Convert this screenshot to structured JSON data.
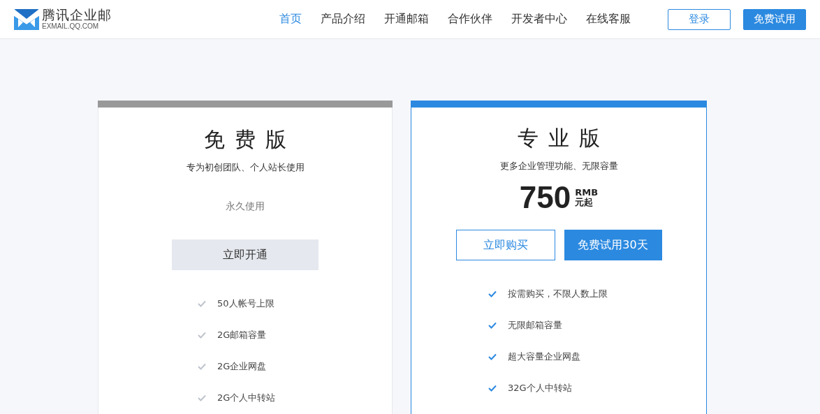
{
  "header": {
    "logo": {
      "name": "腾讯企业邮",
      "domain": "EXMAIL.QQ.COM"
    },
    "nav": [
      {
        "label": "首页",
        "selected": true
      },
      {
        "label": "产品介绍",
        "selected": false
      },
      {
        "label": "开通邮箱",
        "selected": false
      },
      {
        "label": "合作伙伴",
        "selected": false
      },
      {
        "label": "开发者中心",
        "selected": false
      },
      {
        "label": "在线客服",
        "selected": false
      }
    ],
    "actions": [
      {
        "label": "登录",
        "kind": "outline"
      },
      {
        "label": "免费试用",
        "kind": "primary"
      }
    ]
  },
  "plans": [
    {
      "title": "免费版",
      "highlighted": false,
      "subtitle": "专为初创团队、个人站长使用",
      "note": "永久使用",
      "buttons": [
        {
          "label": "立即开通",
          "kind": "plain"
        }
      ],
      "features": [
        "50人帐号上限",
        "2G邮箱容量",
        "2G企业网盘",
        "2G个人中转站"
      ]
    },
    {
      "title": "专业版",
      "highlighted": true,
      "subtitle": "更多企业管理功能、无限容量",
      "price": {
        "amount": "750",
        "currency": "RMB",
        "unit": "元起"
      },
      "buttons": [
        {
          "label": "立即购买",
          "kind": "outline"
        },
        {
          "label": "免费试用30天",
          "kind": "primary"
        }
      ],
      "features": [
        "按需购买，不限人数上限",
        "无限邮箱容量",
        "超大容量企业网盘",
        "32G个人中转站"
      ]
    }
  ]
}
